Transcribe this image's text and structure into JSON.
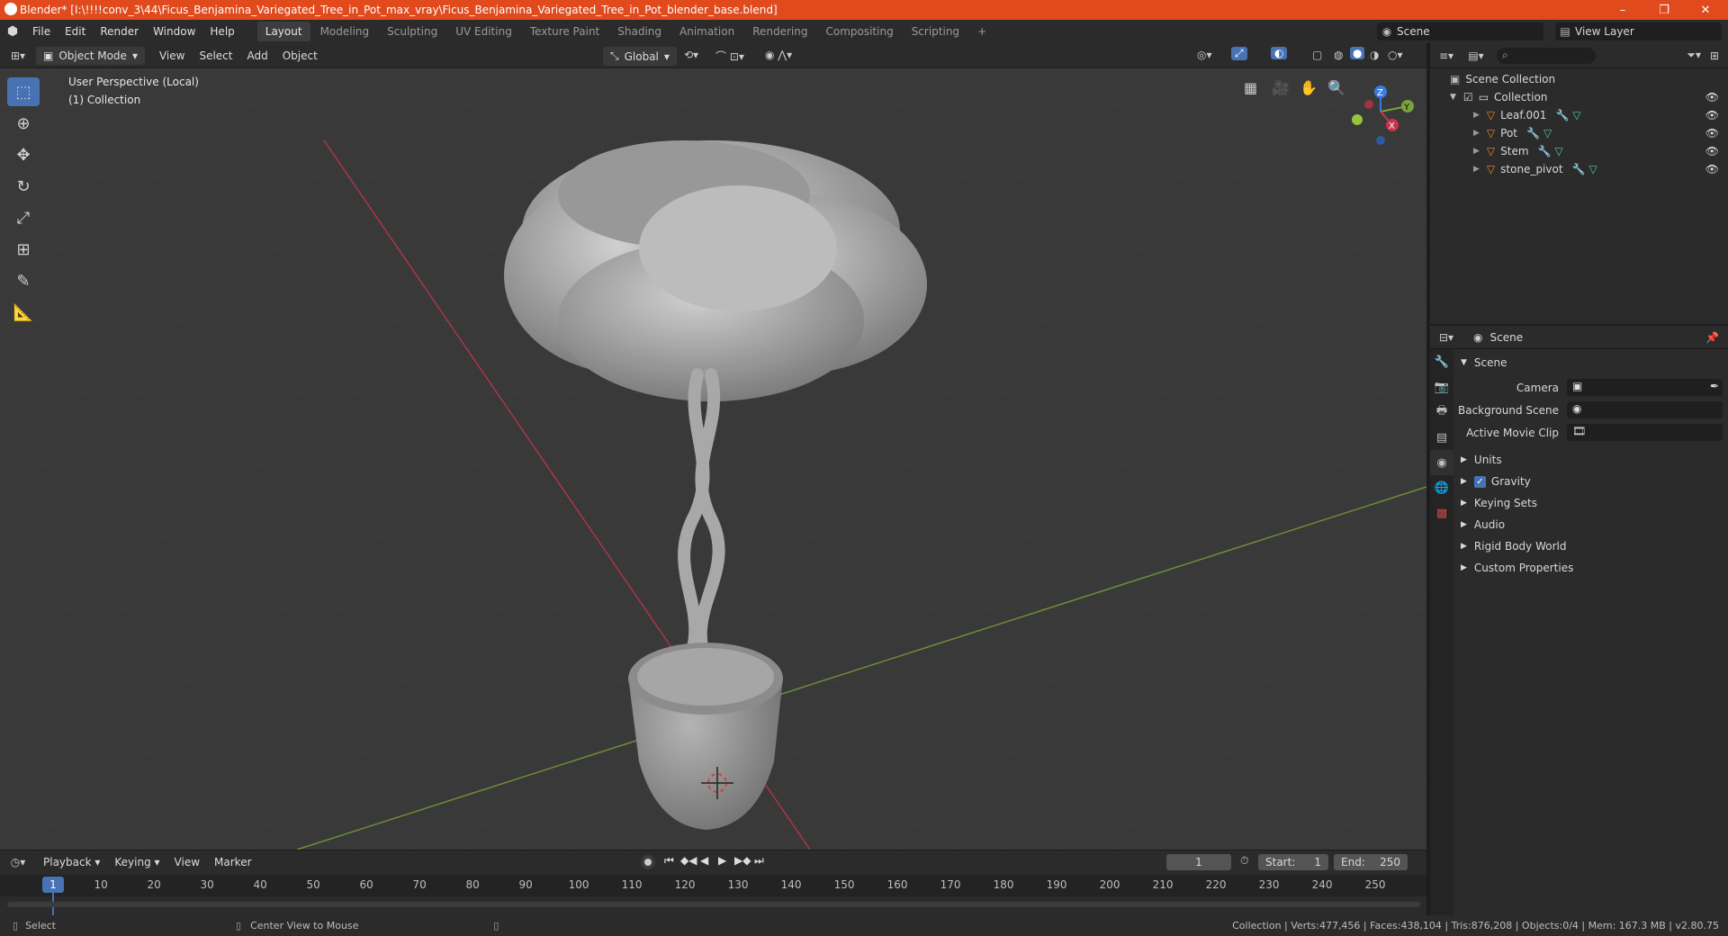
{
  "window": {
    "title": "Blender* [I:\\!!!!conv_3\\44\\Ficus_Benjamina_Variegated_Tree_in_Pot_max_vray\\Ficus_Benjamina_Variegated_Tree_in_Pot_blender_base.blend]",
    "minimize": "–",
    "restore": "❐",
    "close": "✕"
  },
  "menu": [
    "File",
    "Edit",
    "Render",
    "Window",
    "Help"
  ],
  "workspaces": [
    "Layout",
    "Modeling",
    "Sculpting",
    "UV Editing",
    "Texture Paint",
    "Shading",
    "Animation",
    "Rendering",
    "Compositing",
    "Scripting"
  ],
  "workspace_add": "+",
  "scene_field": "Scene",
  "view_layer_field": "View Layer",
  "viewport": {
    "mode": "Object Mode",
    "menus": [
      "View",
      "Select",
      "Add",
      "Object"
    ],
    "orientation": "Global",
    "perspective_label": "User Perspective (Local)",
    "collection_label": "(1) Collection",
    "gizmo_axes": {
      "x": "X",
      "y": "Y",
      "z": "Z"
    }
  },
  "outliner": {
    "search_placeholder": "",
    "root": "Scene Collection",
    "collection": "Collection",
    "items": [
      "Leaf.001",
      "Pot",
      "Stem",
      "stone_pivot"
    ]
  },
  "properties": {
    "context": "Scene",
    "section": "Scene",
    "camera_label": "Camera",
    "background_scene_label": "Background Scene",
    "active_movie_clip_label": "Active Movie Clip",
    "panels": [
      "Units",
      "Gravity",
      "Keying Sets",
      "Audio",
      "Rigid Body World",
      "Custom Properties"
    ],
    "gravity_checked": true
  },
  "timeline": {
    "menus": [
      "Playback",
      "Keying",
      "View",
      "Marker"
    ],
    "current_frame": "1",
    "start_label": "Start:",
    "start": "1",
    "end_label": "End:",
    "end": "250",
    "ruler": [
      "1",
      "10",
      "20",
      "30",
      "40",
      "50",
      "60",
      "70",
      "80",
      "90",
      "100",
      "110",
      "120",
      "130",
      "140",
      "150",
      "160",
      "170",
      "180",
      "190",
      "200",
      "210",
      "220",
      "230",
      "240",
      "250"
    ]
  },
  "statusbar": {
    "select": "Select",
    "center_view": "Center View to Mouse",
    "stats": "Collection | Verts:477,456 | Faces:438,104 | Tris:876,208 | Objects:0/4 | Mem: 167.3 MB | v2.80.75"
  },
  "colors": {
    "titlebar": "#e04a1d",
    "accent": "#4772b3",
    "x_axis": "#c8354a",
    "y_axis": "#7aa33a",
    "z_axis": "#3a7be0",
    "object_icon": "#e6902b",
    "modifier_icon": "#5aa0e0",
    "mesh_icon": "#4fc9a0"
  }
}
